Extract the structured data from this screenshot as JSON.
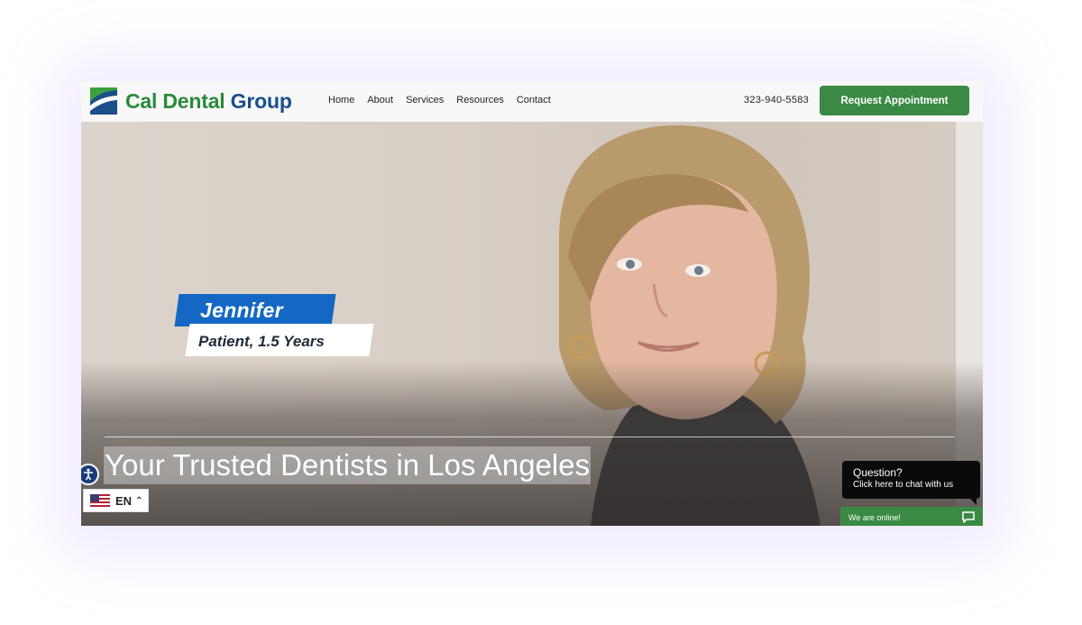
{
  "brand": {
    "name_part1": "Cal Dental",
    "name_part2": " Group"
  },
  "nav": [
    "Home",
    "About",
    "Services",
    "Resources",
    "Contact"
  ],
  "phone": "323-940-5583",
  "cta_label": "Request Appointment",
  "hero": {
    "name_tag": "Jennifer",
    "sub_tag": "Patient, 1.5 Years",
    "headline": "Your Trusted Dentists in Los Angeles"
  },
  "language": {
    "code": "EN"
  },
  "chat": {
    "question": "Question?",
    "prompt": "Click here to chat with us",
    "status": "We are online!"
  },
  "colors": {
    "brand_green": "#3b8a44",
    "brand_blue": "#1a4f8c",
    "tag_blue": "#1468c4"
  }
}
